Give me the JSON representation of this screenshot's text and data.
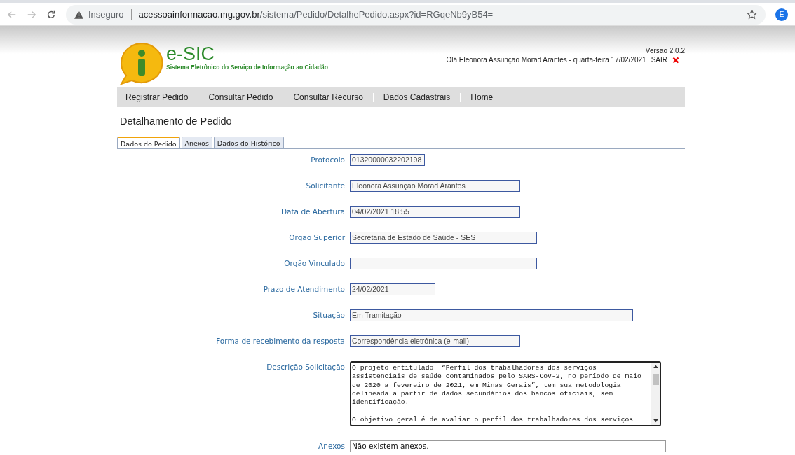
{
  "browser": {
    "security": "Inseguro",
    "url_host": "acessoainformacao.mg.gov.br",
    "url_path": "/sistema/Pedido/DetalhePedido.aspx?id=RGqeNb9yB54=",
    "profile": "E"
  },
  "header": {
    "logo_title": "e-SIC",
    "logo_subtitle": "Sistema Eletrônico do Serviço de Informação ao Cidadão",
    "version": "Versão 2.0.2",
    "greeting": "Olá Eleonora Assunção Morad Arantes - quarta-feira 17/02/2021",
    "logout": "SAIR"
  },
  "nav": [
    "Registrar Pedido",
    "Consultar Pedido",
    "Consultar Recurso",
    "Dados Cadastrais",
    "Home"
  ],
  "page_title": "Detalhamento de Pedido",
  "tabs": [
    {
      "label": "Dados do Pedido",
      "selected": true
    },
    {
      "label": "Anexos",
      "selected": false
    },
    {
      "label": "Dados do Histórico",
      "selected": false
    }
  ],
  "fields": [
    {
      "kind": "input",
      "label": "Protocolo",
      "value": "01320000032202198"
    },
    {
      "kind": "input",
      "label": "Solicitante",
      "value": "Eleonora Assunção Morad Arantes"
    },
    {
      "kind": "input",
      "label": "Data de Abertura",
      "value": "04/02/2021 18:55"
    },
    {
      "kind": "input",
      "label": "Orgão Superior",
      "value": "Secretaria de Estado de Saúde - SES"
    },
    {
      "kind": "input",
      "label": "Orgão Vinculado"
    },
    {
      "kind": "input",
      "label": "Prazo de Atendimento",
      "value": "24/02/2021"
    },
    {
      "kind": "input",
      "label": "Situação",
      "value": "Em Tramitação"
    },
    {
      "kind": "input",
      "label": "Forma de recebimento da resposta",
      "value": "Correspondência eletrônica (e-mail)"
    },
    {
      "kind": "textarea",
      "label": "Descrição Solicitação",
      "paragraphs": [
        "O projeto entitulado  “Perfil dos trabalhadores dos serviços assistenciais de saúde contaminados pelo SARS-CoV-2, no período de maio de 2020 a fevereiro de 2021, em Minas Gerais”, tem sua metodologia delineada a partir de dados secundários dos bancos oficiais, sem identificação.",
        "O objetivo geral é de avaliar o perfil dos trabalhadores dos serviços"
      ]
    },
    {
      "kind": "box",
      "label": "Anexos",
      "value": "Não existem anexos."
    }
  ]
}
